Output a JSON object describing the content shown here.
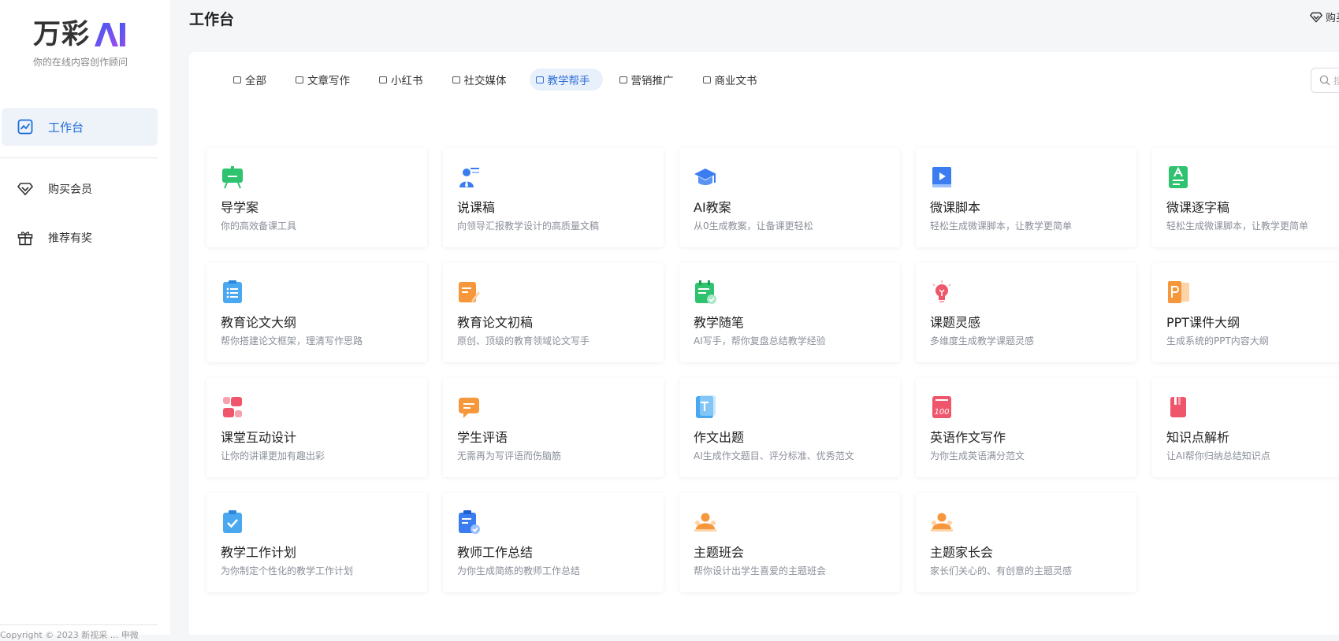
{
  "app": {
    "logo_text": "万彩",
    "logo_suffix": "AI",
    "slogan": "你的在线内容创作顾问"
  },
  "sidebar": {
    "items": [
      {
        "label": "工作台",
        "icon": "chart-line-icon"
      },
      {
        "label": "购买会员",
        "icon": "diamond-icon"
      },
      {
        "label": "推荐有奖",
        "icon": "gift-icon"
      }
    ],
    "copyright": "Copyright © 2023 新视采 ... 申微"
  },
  "header": {
    "title": "工作台",
    "topright_label": "购买会员"
  },
  "tabs": [
    {
      "label": "全部"
    },
    {
      "label": "文章写作"
    },
    {
      "label": "小红书"
    },
    {
      "label": "社交媒体"
    },
    {
      "label": "教学帮手",
      "active": true
    },
    {
      "label": "营销推广"
    },
    {
      "label": "商业文书"
    }
  ],
  "search": {
    "placeholder": "搜索"
  },
  "cards": [
    {
      "title": "导学案",
      "desc": "你的高效备课工具",
      "icon": "blackboard-icon",
      "color": "#2fc26f"
    },
    {
      "title": "说课稿",
      "desc": "向领导汇报教学设计的高质量文稿",
      "icon": "presenter-icon",
      "color": "#3b7cf0"
    },
    {
      "title": "AI教案",
      "desc": "从0生成教案，让备课更轻松",
      "icon": "graduation-cap-icon",
      "color": "#3b7cf0"
    },
    {
      "title": "微课脚本",
      "desc": "轻松生成微课脚本，让教学更简单",
      "icon": "video-book-icon",
      "color": "#3b7cf0"
    },
    {
      "title": "微课逐字稿",
      "desc": "轻松生成微课脚本，让教学更简单",
      "icon": "letter-doc-icon",
      "color": "#2fc26f"
    },
    {
      "title": "教育论文大纲",
      "desc": "帮你搭建论文框架，理清写作思路",
      "icon": "list-doc-icon",
      "color": "#4aa8f0"
    },
    {
      "title": "教育论文初稿",
      "desc": "原创、顶级的教育领域论文写手",
      "icon": "edit-doc-icon",
      "color": "#f5973a"
    },
    {
      "title": "教学随笔",
      "desc": "AI写手，帮你复盘总结教学经验",
      "icon": "check-note-icon",
      "color": "#2fc26f"
    },
    {
      "title": "课题灵感",
      "desc": "多维度生成教学课题灵感",
      "icon": "lightbulb-icon",
      "color": "#f0566b"
    },
    {
      "title": "PPT课件大纲",
      "desc": "生成系统的PPT内容大纲",
      "icon": "ppt-icon",
      "color": "#f5973a"
    },
    {
      "title": "课堂互动设计",
      "desc": "让你的讲课更加有趣出彩",
      "icon": "interaction-icon",
      "color": "#f0566b"
    },
    {
      "title": "学生评语",
      "desc": "无需再为写评语而伤脑筋",
      "icon": "comment-icon",
      "color": "#f5973a"
    },
    {
      "title": "作文出题",
      "desc": "AI生成作文题目、评分标准、优秀范文",
      "icon": "text-doc-icon",
      "color": "#4aa8f0"
    },
    {
      "title": "英语作文写作",
      "desc": "为你生成英语满分范文",
      "icon": "score-100-icon",
      "color": "#f0566b"
    },
    {
      "title": "知识点解析",
      "desc": "让AI帮你归纳总结知识点",
      "icon": "red-book-icon",
      "color": "#f0566b"
    },
    {
      "title": "教学工作计划",
      "desc": "为你制定个性化的教学工作计划",
      "icon": "check-clipboard-icon",
      "color": "#4aa8f0"
    },
    {
      "title": "教师工作总结",
      "desc": "为你生成简练的教师工作总结",
      "icon": "summary-clipboard-icon",
      "color": "#3b7cf0"
    },
    {
      "title": "主题班会",
      "desc": "帮你设计出学生喜爱的主题班会",
      "icon": "class-meeting-icon",
      "color": "#f5973a"
    },
    {
      "title": "主题家长会",
      "desc": "家长们关心的、有创意的主题灵感",
      "icon": "parents-meeting-icon",
      "color": "#f5973a"
    }
  ]
}
